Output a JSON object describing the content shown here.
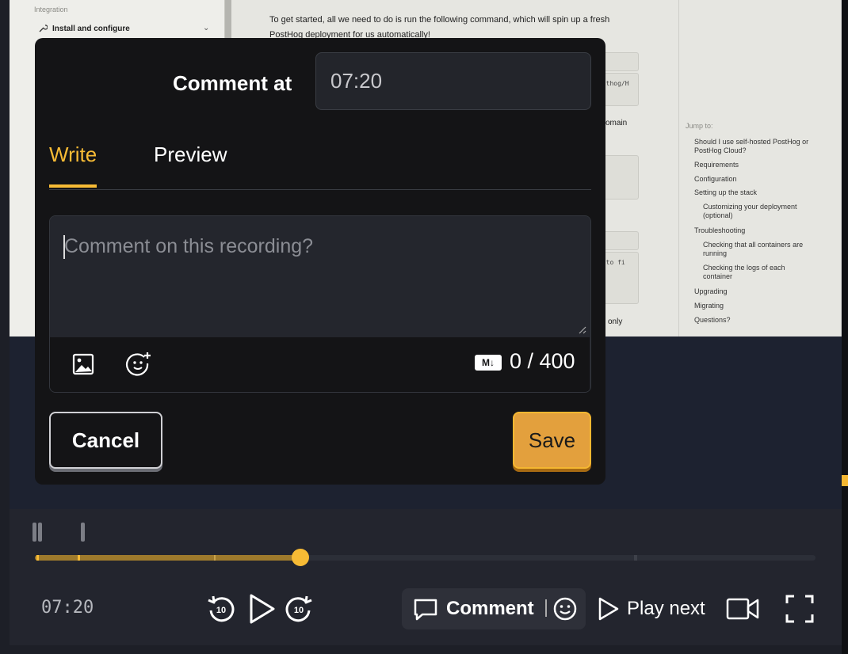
{
  "recording_page": {
    "sidebar": {
      "section_label": "Integration",
      "item_label": "Install and configure"
    },
    "content": {
      "paragraph": "To get started, all we need to do is run the following command, which will spin up a fresh PostHog deployment for us automatically!",
      "code_snippet_1": "osthog/H",
      "code_snippet_2": "s to fi",
      "fragment_domain": "omain",
      "fragment_only": "only"
    },
    "toc": {
      "title": "Jump to:",
      "items": [
        "Should I use self-hosted PostHog or PostHog Cloud?",
        "Requirements",
        "Configuration",
        "Setting up the stack",
        "Customizing your deployment (optional)",
        "Troubleshooting",
        "Checking that all containers are running",
        "Checking the logs of each container",
        "Upgrading",
        "Migrating",
        "Questions?"
      ]
    }
  },
  "modal": {
    "title": "Comment at",
    "timestamp_value": "07:20",
    "tabs": [
      {
        "label": "Write",
        "active": true
      },
      {
        "label": "Preview",
        "active": false
      }
    ],
    "editor": {
      "placeholder": "Comment on this recording?",
      "markdown_badge": "M↓",
      "char_count": "0 / 400",
      "image_icon": "image-icon",
      "emoji_icon": "add-emoji-icon"
    },
    "cancel_label": "Cancel",
    "save_label": "Save"
  },
  "player": {
    "current_time": "07:20",
    "progress_fraction": 0.34,
    "skip_back_label": "10",
    "skip_forward_label": "10",
    "comment_label": "Comment",
    "play_next_label": "Play next"
  },
  "colors": {
    "accent": "#f7bb35",
    "save_button": "#e3a03d",
    "modal_bg": "#141416"
  }
}
